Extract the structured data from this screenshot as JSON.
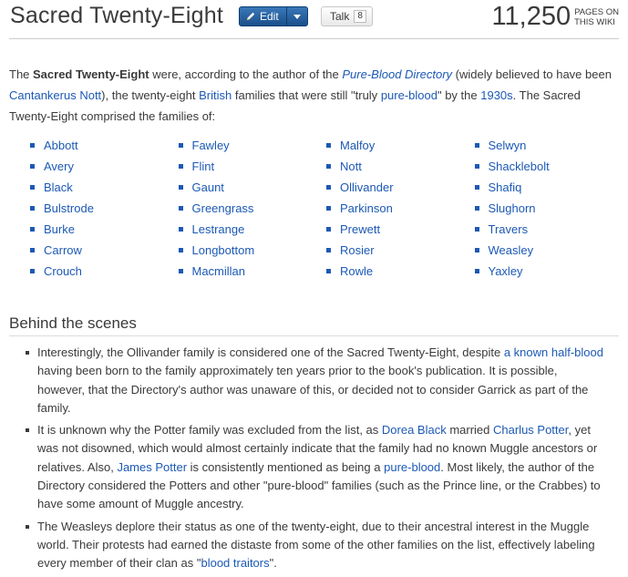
{
  "header": {
    "title": "Sacred Twenty-Eight",
    "edit_label": "Edit",
    "talk_label": "Talk",
    "talk_count": "8",
    "pages_count": "11,250",
    "pages_label_line1": "PAGES ON",
    "pages_label_line2": "THIS WIKI"
  },
  "intro": {
    "t1": "The ",
    "bold": "Sacred Twenty-Eight",
    "t2": " were, according to the author of the ",
    "link_directory": "Pure-Blood Directory",
    "t3": " (widely believed to have been ",
    "link_nott": "Cantankerus Nott",
    "t4": "), the twenty-eight ",
    "link_british": "British",
    "t5": " families that were still \"truly ",
    "link_pureblood": "pure-blood",
    "t6": "\" by the ",
    "link_1930s": "1930s",
    "t7": ". The Sacred Twenty-Eight comprised the families of:"
  },
  "families": [
    [
      "Abbott",
      "Avery",
      "Black",
      "Bulstrode",
      "Burke",
      "Carrow",
      "Crouch"
    ],
    [
      "Fawley",
      "Flint",
      "Gaunt",
      "Greengrass",
      "Lestrange",
      "Longbottom",
      "Macmillan"
    ],
    [
      "Malfoy",
      "Nott",
      "Ollivander",
      "Parkinson",
      "Prewett",
      "Rosier",
      "Rowle"
    ],
    [
      "Selwyn",
      "Shacklebolt",
      "Shafiq",
      "Slughorn",
      "Travers",
      "Weasley",
      "Yaxley"
    ]
  ],
  "behind": {
    "heading": "Behind the scenes",
    "n1": {
      "t1": "Interestingly, the Ollivander family is considered one of the Sacred Twenty-Eight, despite ",
      "link": "a known half-blood",
      "t2": " having been born to the family approximately ten years prior to the book's publication. It is possible, however, that the Directory's author was unaware of this, or decided not to consider Garrick as part of the family."
    },
    "n2": {
      "t1": "It is unknown why the Potter family was excluded from the list, as ",
      "link1": "Dorea Black",
      "t2": " married ",
      "link2": "Charlus Potter",
      "t3": ", yet was not disowned, which would almost certainly indicate that the family had no known Muggle ancestors or relatives. Also, ",
      "link3": "James Potter",
      "t4": " is consistently mentioned as being a ",
      "link4": "pure-blood",
      "t5": ". Most likely, the author of the Directory considered the Potters and other \"pure-blood\" families (such as the Prince line, or the Crabbes) to have some amount of Muggle ancestry."
    },
    "n3": {
      "t1": "The Weasleys deplore their status as one of the twenty-eight, due to their ancestral interest in the Muggle world. Their protests had earned the distaste from some of the other families on the list, effectively labeling every member of their clan as \"",
      "link": "blood traitors",
      "t2": "\"."
    }
  }
}
